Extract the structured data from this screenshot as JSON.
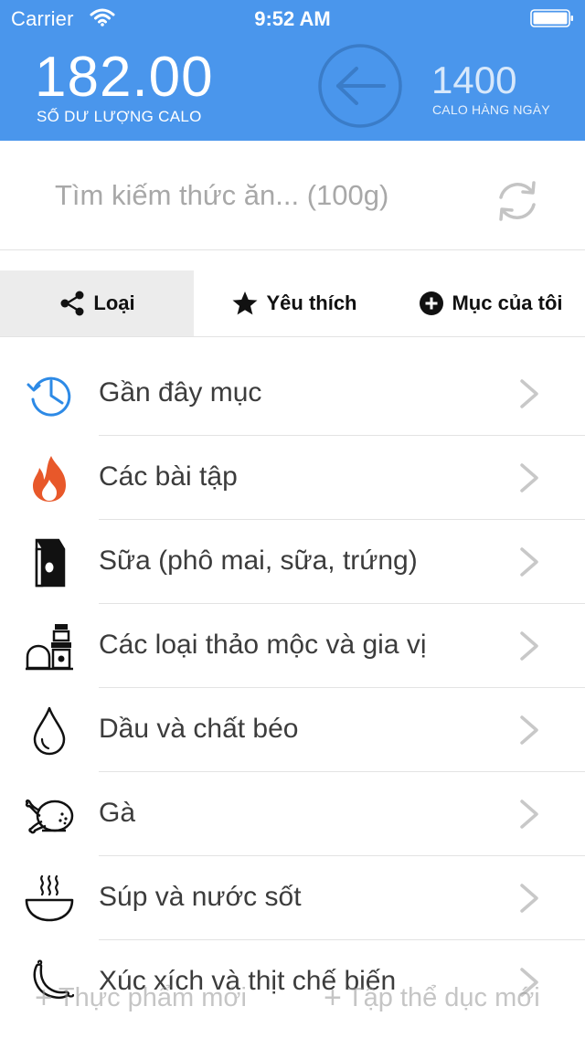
{
  "status_bar": {
    "carrier": "Carrier",
    "time": "9:52 AM"
  },
  "header": {
    "balance_value": "182.00",
    "balance_label": "SỐ DƯ LƯỢNG CALO",
    "daily_value": "1400",
    "daily_label": "CALO HÀNG NGÀY",
    "back_icon": "left-arrow-circle-icon",
    "background_color": "#4a96ec"
  },
  "search": {
    "placeholder": "Tìm kiếm thức ăn... (100g)",
    "refresh_icon": "refresh-icon"
  },
  "tabs": [
    {
      "label": "Loại",
      "icon": "share-icon",
      "active": true
    },
    {
      "label": "Yêu thích",
      "icon": "star-icon",
      "active": false
    },
    {
      "label": "Mục của tôi",
      "icon": "plus-circle-icon",
      "active": false
    }
  ],
  "categories": [
    {
      "label": "Gần đây mục",
      "icon": "clock-history-icon"
    },
    {
      "label": "Các bài tập",
      "icon": "flame-icon"
    },
    {
      "label": "Sữa (phô mai, sữa, trứng)",
      "icon": "milk-carton-icon"
    },
    {
      "label": "Các loại thảo mộc và gia vị",
      "icon": "spice-grinder-icon"
    },
    {
      "label": "Dầu và chất béo",
      "icon": "oil-drop-icon"
    },
    {
      "label": "Gà",
      "icon": "roast-chicken-icon"
    },
    {
      "label": "Súp và nước sốt",
      "icon": "soup-bowl-icon"
    },
    {
      "label": "Xúc xích và thịt chế biến",
      "icon": "sausage-icon"
    }
  ],
  "bottom": {
    "new_food": "Thực phẩm mới",
    "new_exercise": "Tập thể dục mới"
  },
  "colors": {
    "accent": "#4a96ec",
    "flame": "#e8582a",
    "divider": "#e3e3e3"
  }
}
